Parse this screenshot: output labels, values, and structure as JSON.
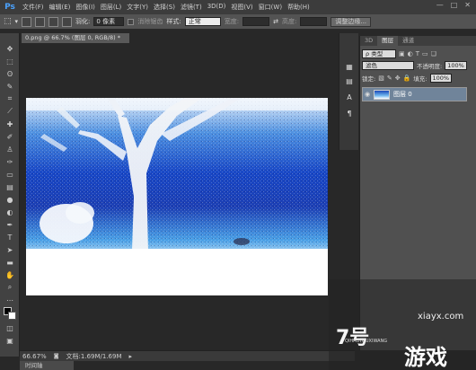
{
  "app": {
    "logo": "Ps"
  },
  "menu": [
    "文件(F)",
    "编辑(E)",
    "图像(I)",
    "图层(L)",
    "文字(Y)",
    "选择(S)",
    "滤镜(T)",
    "3D(D)",
    "视图(V)",
    "窗口(W)",
    "帮助(H)"
  ],
  "window_controls": {
    "minimize": "—",
    "maximize": "□",
    "close": "✕"
  },
  "options_bar": {
    "feather_label": "羽化:",
    "feather_value": "0 像素",
    "antialias_label": "消除锯齿",
    "style_label": "样式:",
    "style_value": "正常",
    "width_label": "宽度:",
    "height_label": "高度:",
    "refine_edge_button": "调整边缘..."
  },
  "document": {
    "tab_title": "0.png @ 66.7% (图层 0, RGB/8) *",
    "close": "×"
  },
  "status": {
    "zoom": "66.67%",
    "doc_info": "文档:1.69M/1.69M"
  },
  "bottom_tab": "时间轴",
  "layers_panel": {
    "tabs": [
      "3D",
      "图层",
      "通道"
    ],
    "active_tab": 1,
    "filter_kind": "ρ 类型",
    "blend_mode": "滤色",
    "opacity_label": "不透明度:",
    "opacity_value": "100%",
    "lock_label": "锁定:",
    "fill_label": "填充:",
    "fill_value": "100%",
    "layers": [
      {
        "name": "图层 0",
        "visible": true
      }
    ]
  },
  "watermark": {
    "url": "xiayx.com",
    "big": "7号",
    "game": "游戏",
    "pinyin": "QIHAOYOUXIWANG"
  },
  "colors": {
    "chrome": "#535353",
    "menubar": "#3c3c3c",
    "canvas_bg": "#282828",
    "image_blue": "#1a3fbf",
    "layer_highlight": "#70849a"
  }
}
